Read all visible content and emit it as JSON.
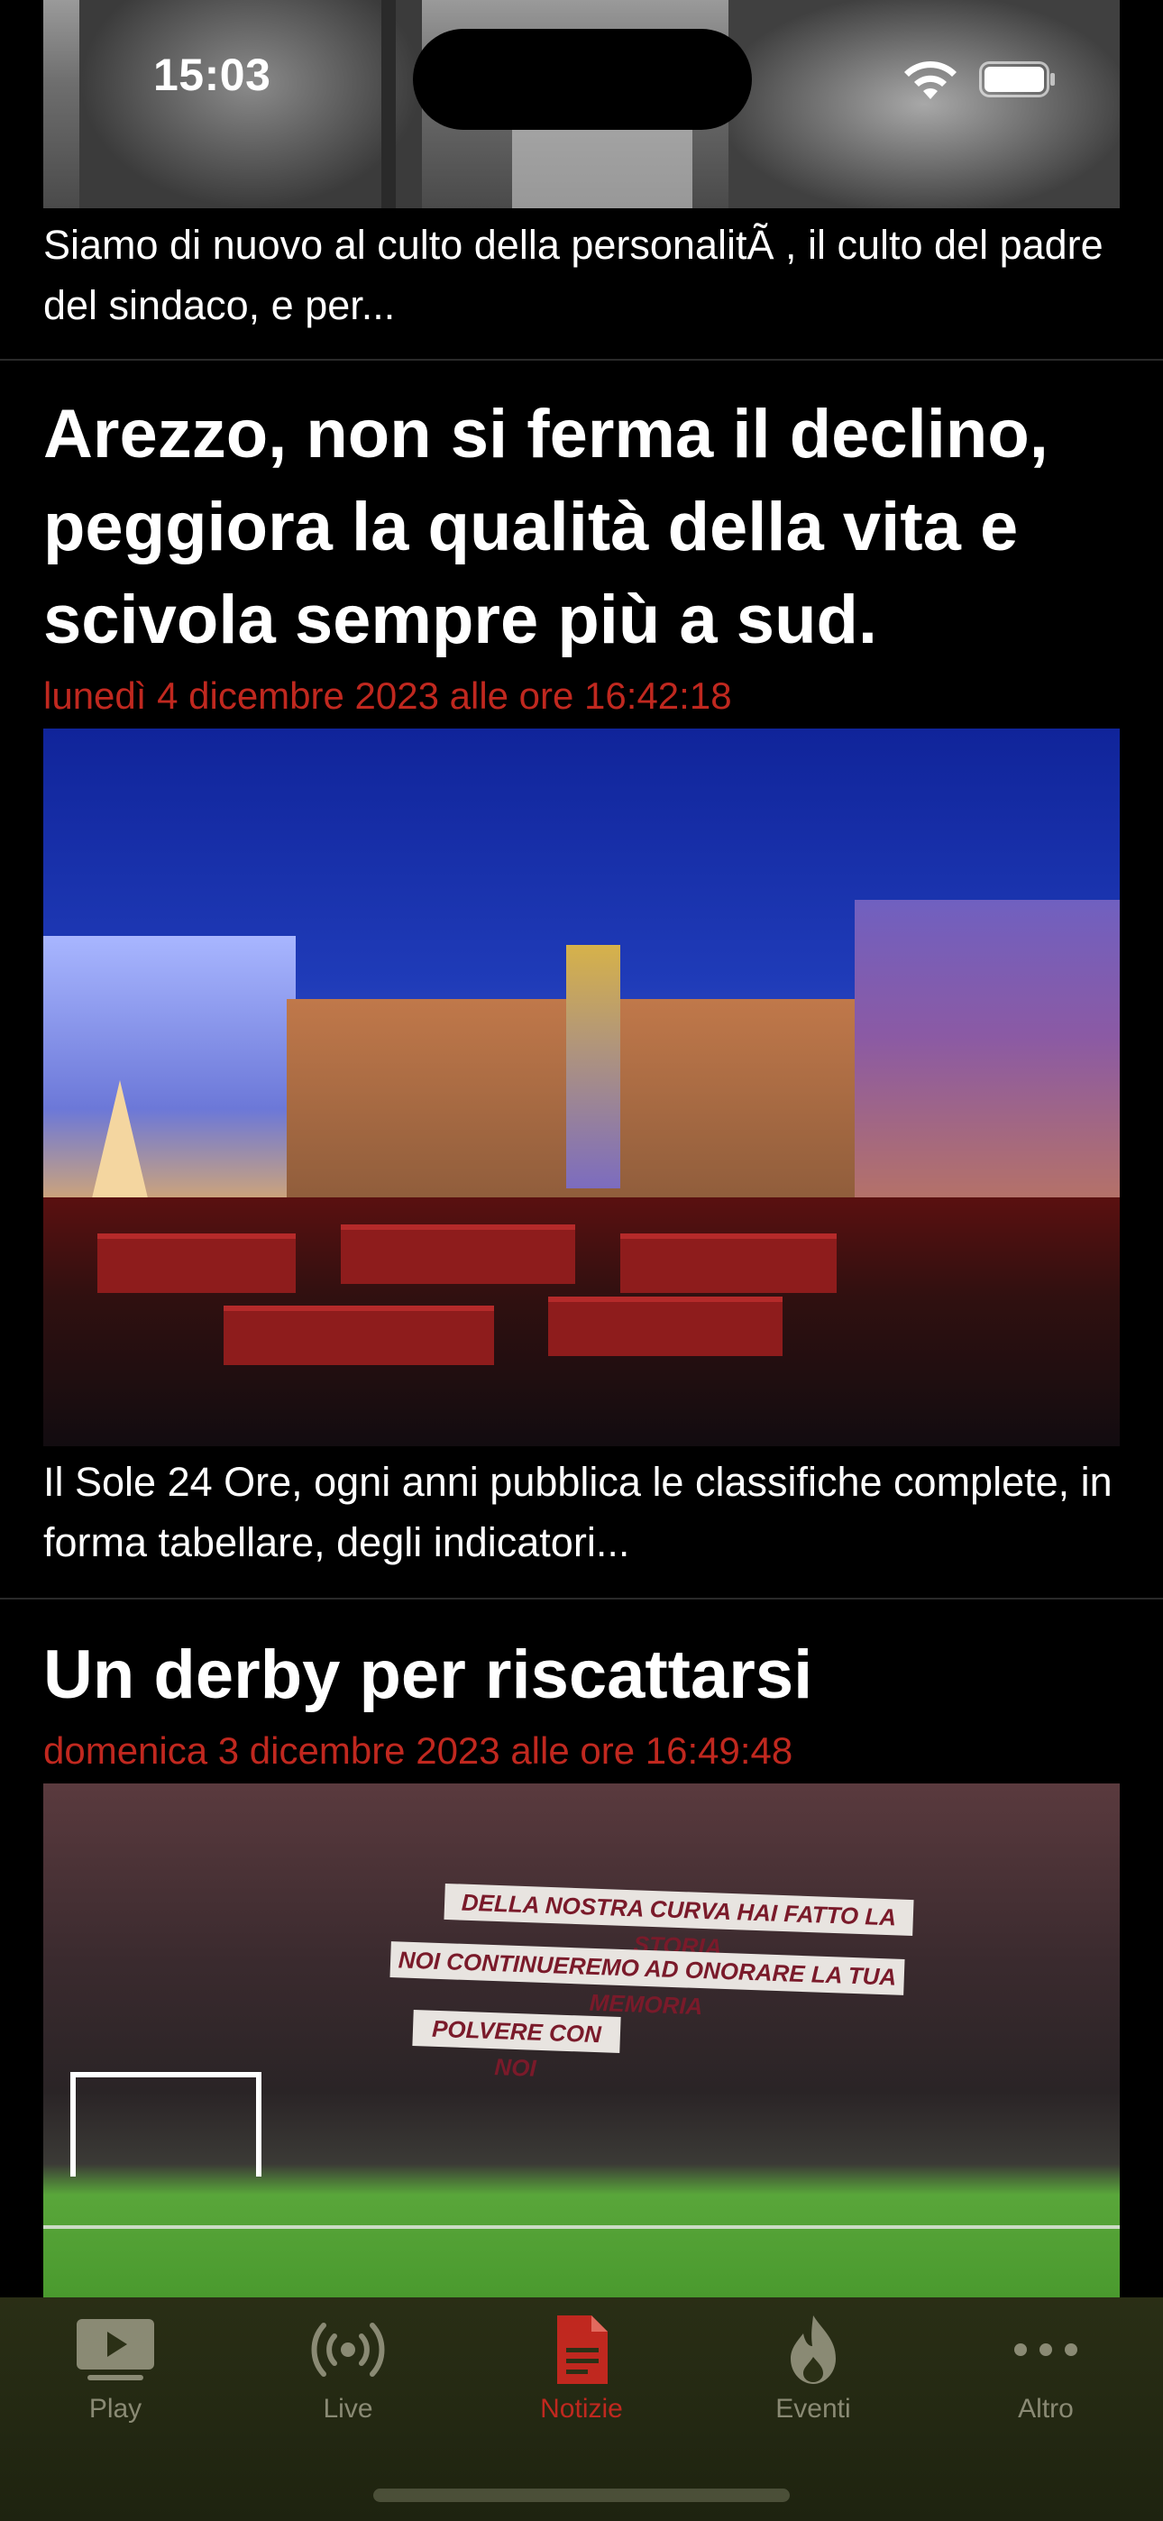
{
  "status_bar": {
    "time": "15:03"
  },
  "top_article": {
    "snippet": "Siamo di nuovo al culto della personalitÃ , il culto del padre del sindaco, e per..."
  },
  "articles": [
    {
      "title": "Arezzo, non si ferma il declino, peggiora la qualità della vita e scivola sempre più a sud.",
      "date": "lunedì 4 dicembre 2023 alle ore 16:42:18",
      "snippet": "Il Sole 24 Ore, ogni anni pubblica le classifiche complete, in forma tabellare, degli indicatori..."
    },
    {
      "title": "Un derby per riscattarsi",
      "date": "domenica 3 dicembre 2023 alle ore 16:49:48",
      "banners": [
        "DELLA NOSTRA CURVA HAI FATTO LA STORIA",
        "NOI CONTINUEREMO AD ONORARE LA TUA MEMORIA",
        "POLVERE CON NOI"
      ]
    }
  ],
  "tab_bar": {
    "tabs": [
      {
        "label": "Play",
        "icon": "play-icon"
      },
      {
        "label": "Live",
        "icon": "broadcast-icon"
      },
      {
        "label": "Notizie",
        "icon": "document-icon"
      },
      {
        "label": "Eventi",
        "icon": "flame-icon"
      },
      {
        "label": "Altro",
        "icon": "more-icon"
      }
    ],
    "active_color": "#c0281f",
    "inactive_color": "#8a8a74"
  },
  "colors": {
    "date": "#c0281f",
    "background": "#000000"
  }
}
